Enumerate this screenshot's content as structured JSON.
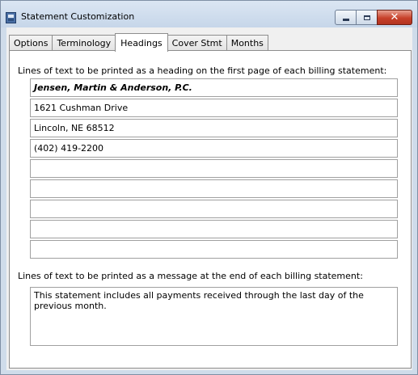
{
  "window": {
    "title": "Statement Customization",
    "icon": "statement-app-icon",
    "caption_buttons": {
      "minimize": "minimize-icon",
      "maximize": "maximize-icon",
      "close": "close-icon"
    }
  },
  "tabs": [
    {
      "label": "Options",
      "active": false
    },
    {
      "label": "Terminology",
      "active": false
    },
    {
      "label": "Headings",
      "active": true
    },
    {
      "label": "Cover Stmt",
      "active": false
    },
    {
      "label": "Months",
      "active": false
    }
  ],
  "headings": {
    "label": "Lines of text to be printed as a heading on the first page of each billing statement:",
    "lines": [
      "Jensen, Martin & Anderson, P.C.",
      "1621 Cushman Drive",
      "Lincoln, NE 68512",
      "(402) 419-2200",
      "",
      "",
      "",
      "",
      ""
    ]
  },
  "message": {
    "label": "Lines of text to be printed as a message at the end of each billing statement:",
    "text": "This statement includes all payments received through the last day of the previous month."
  }
}
